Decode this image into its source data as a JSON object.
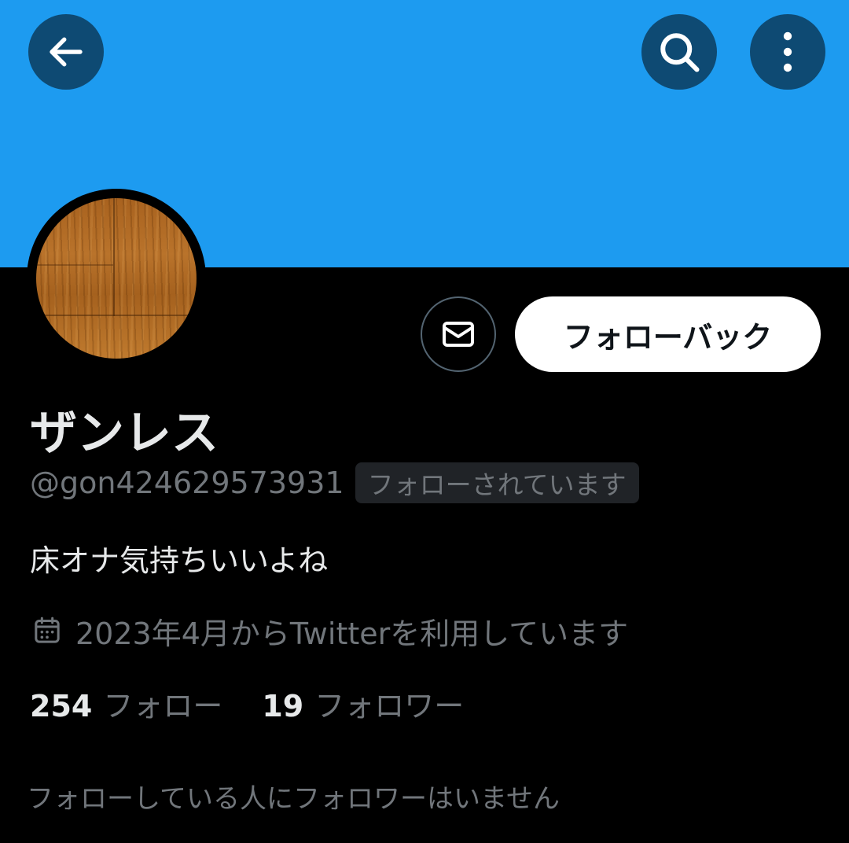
{
  "colors": {
    "banner": "#1d9bf0",
    "icon_button_bg": "#0e4a73",
    "background": "#000000",
    "primary_text": "#e7e9ea",
    "secondary_text": "#71767b"
  },
  "header": {
    "back_icon": "arrow-left-icon",
    "search_icon": "search-icon",
    "more_icon": "more-vertical-icon"
  },
  "profile": {
    "avatar": "wood-texture-avatar",
    "display_name": "ザンレス",
    "handle": "@gon424629573931",
    "follows_you_badge": "フォローされています",
    "bio": "床オナ気持ちいいよね",
    "joined_icon": "calendar-icon",
    "joined": "2023年4月からTwitterを利用しています",
    "following_count": "254",
    "following_label": "フォロー",
    "followers_count": "19",
    "followers_label": "フォロワー",
    "mutual_followers_text": "フォローしている人にフォロワーはいません"
  },
  "actions": {
    "message_icon": "mail-icon",
    "follow_back_label": "フォローバック"
  }
}
